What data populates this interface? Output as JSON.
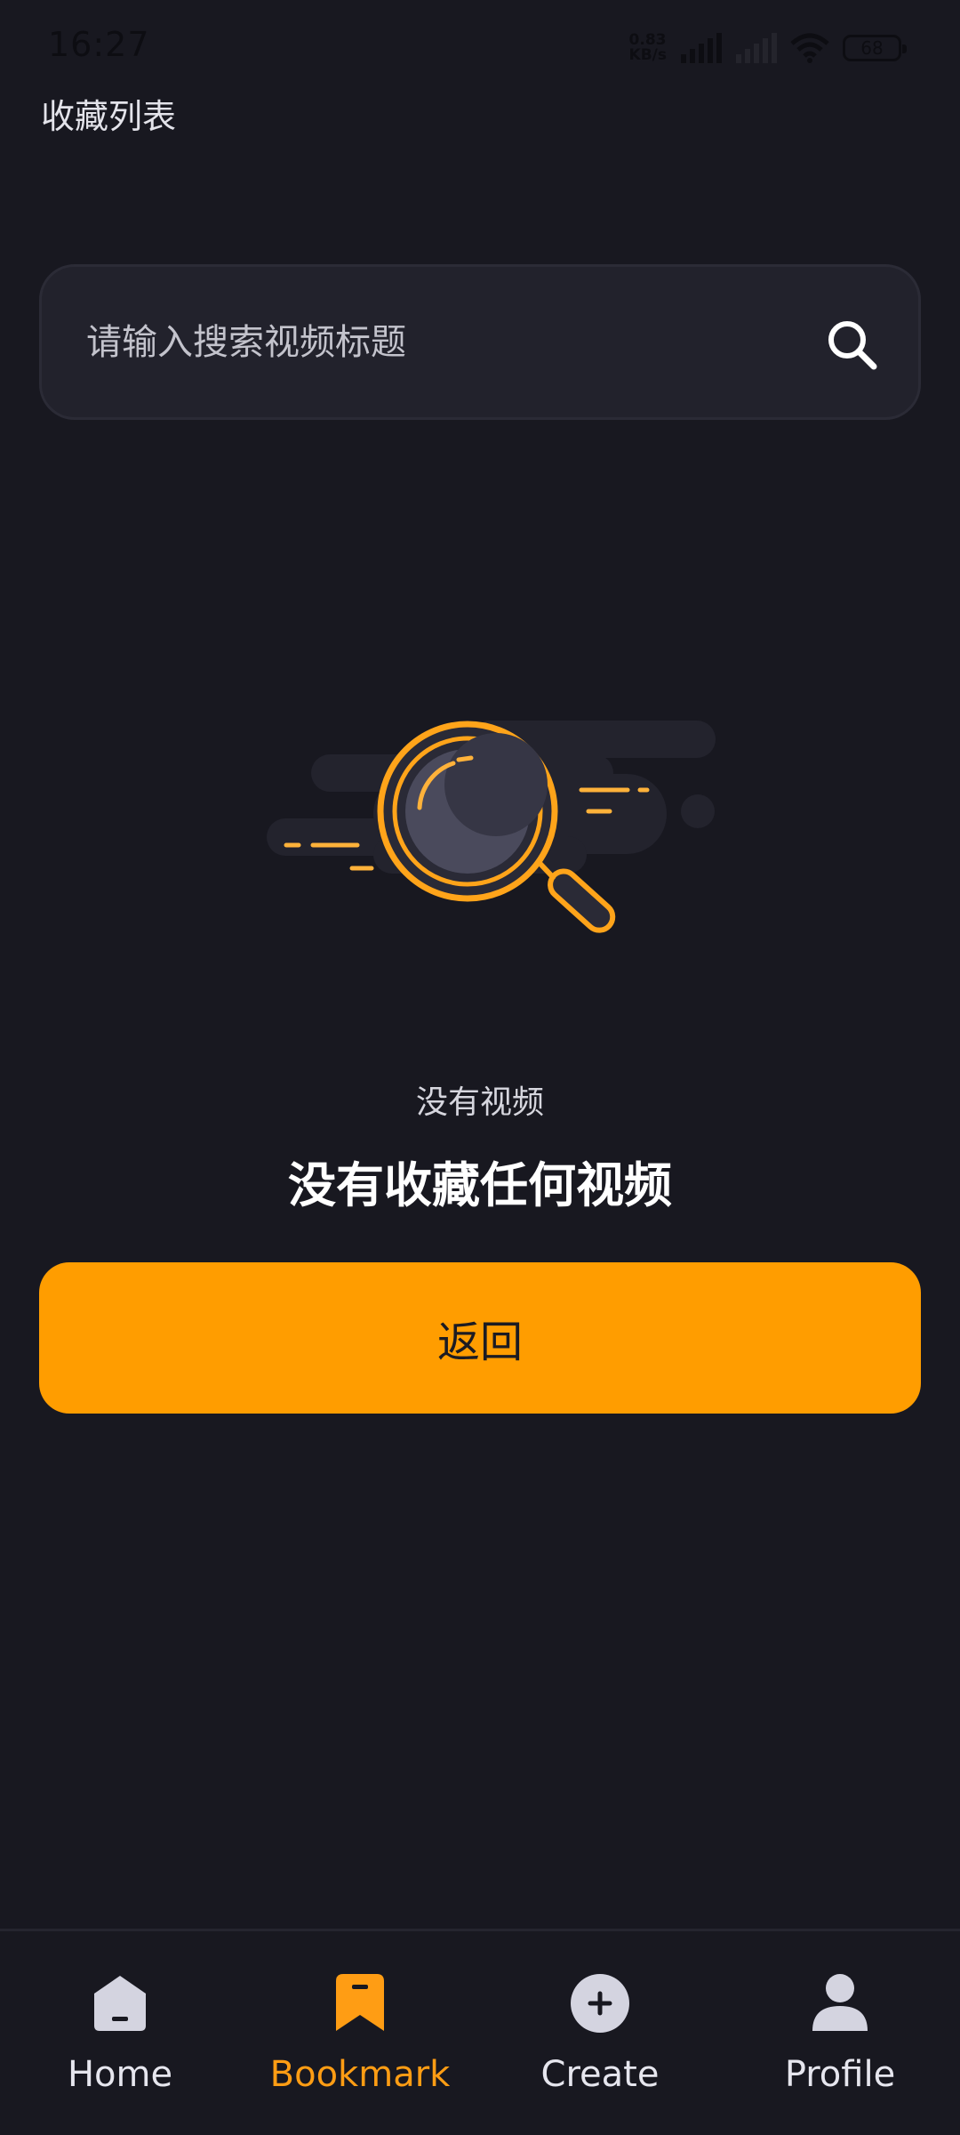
{
  "status_bar": {
    "time": "16:27",
    "net_speed_value": "0.83",
    "net_speed_unit": "KB/s",
    "battery": "68"
  },
  "page": {
    "title": "收藏列表"
  },
  "search": {
    "placeholder": "请输入搜索视频标题"
  },
  "empty_state": {
    "title": "没有视频",
    "message": "没有收藏任何视频",
    "illustration_icon": "magnifier-illustration"
  },
  "back_button": {
    "label": "返回"
  },
  "bottom_nav": {
    "items": [
      {
        "label": "Home",
        "icon": "home-icon",
        "active": false
      },
      {
        "label": "Bookmark",
        "icon": "bookmark-icon",
        "active": true
      },
      {
        "label": "Create",
        "icon": "plus-circle-icon",
        "active": false
      },
      {
        "label": "Profile",
        "icon": "person-icon",
        "active": false
      }
    ]
  },
  "colors": {
    "background": "#181820",
    "accent": "#ff9d00",
    "search_bg": "#22222c",
    "text_primary": "#ffffff",
    "text_secondary": "#d6d6de"
  }
}
